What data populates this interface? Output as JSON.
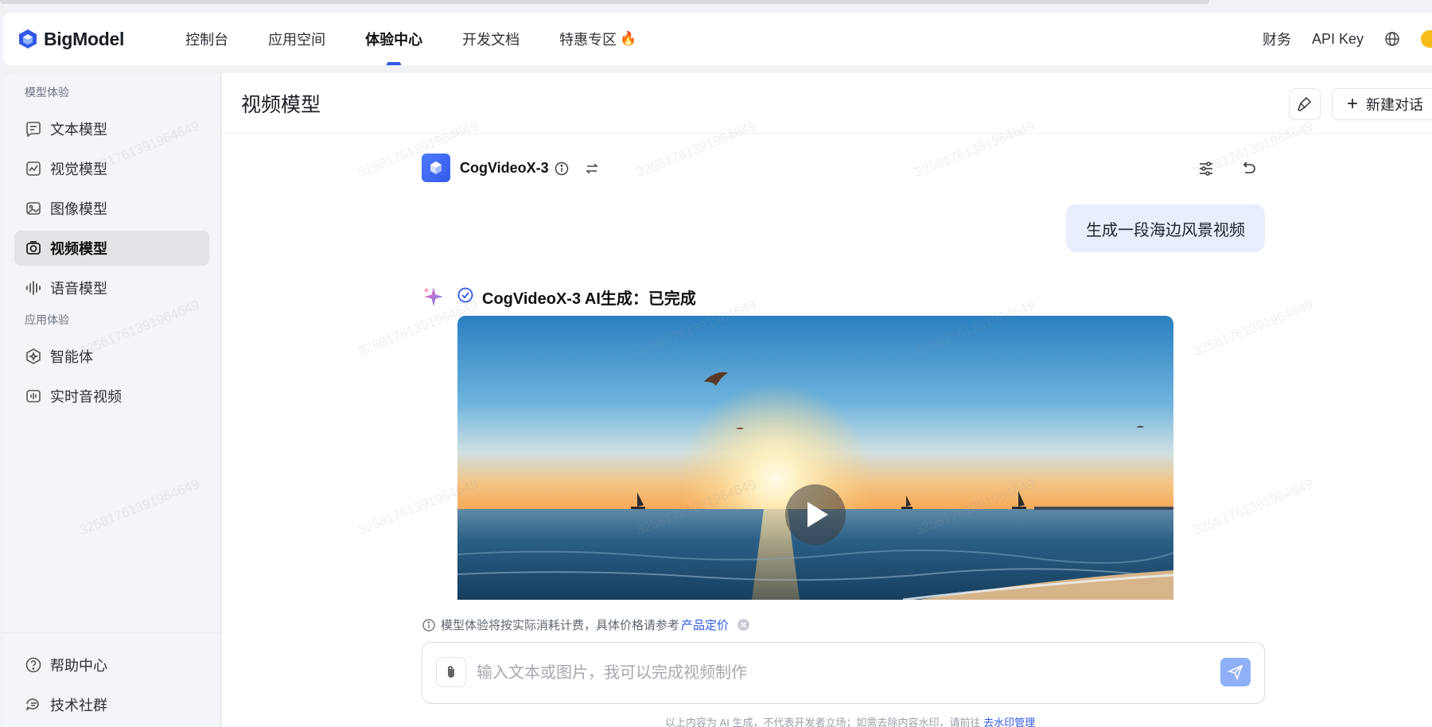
{
  "header": {
    "logo_text": "BigModel",
    "nav": [
      {
        "label": "控制台",
        "active": false
      },
      {
        "label": "应用空间",
        "active": false
      },
      {
        "label": "体验中心",
        "active": true
      },
      {
        "label": "开发文档",
        "active": false
      },
      {
        "label": "特惠专区",
        "active": false,
        "emoji": "🔥"
      }
    ],
    "right": {
      "finance": "财务",
      "api_key": "API Key"
    }
  },
  "sidebar": {
    "section_models": "模型体验",
    "models": [
      {
        "label": "文本模型",
        "icon": "text-icon",
        "active": false
      },
      {
        "label": "视觉模型",
        "icon": "vision-icon",
        "active": false
      },
      {
        "label": "图像模型",
        "icon": "image-icon",
        "active": false
      },
      {
        "label": "视频模型",
        "icon": "video-icon",
        "active": true
      },
      {
        "label": "语音模型",
        "icon": "audio-icon",
        "active": false
      }
    ],
    "section_apps": "应用体验",
    "apps": [
      {
        "label": "智能体",
        "icon": "agent-icon"
      },
      {
        "label": "实时音视频",
        "icon": "realtime-icon"
      }
    ],
    "bottom": [
      {
        "label": "帮助中心",
        "icon": "help-icon"
      },
      {
        "label": "技术社群",
        "icon": "community-icon"
      }
    ]
  },
  "main": {
    "title": "视频模型",
    "new_chat": "新建对话",
    "model_name": "CogVideoX-3",
    "user_message": "生成一段海边风景视频",
    "ai_status": "CogVideoX-3 AI生成：已完成",
    "notice_text": "模型体验将按实际消耗计费，具体价格请参考",
    "notice_link": "产品定价",
    "input_placeholder": "输入文本或图片，我可以完成视频制作",
    "footer_text": "以上内容为 AI 生成，不代表开发者立场；如需去除内容水印，请前往",
    "footer_link": "去水印管理"
  },
  "watermark_text": "325817613919646​49",
  "colors": {
    "accent": "#3258e7",
    "user_bubble": "#e8eefb",
    "send_button": "#8fb0f7"
  }
}
